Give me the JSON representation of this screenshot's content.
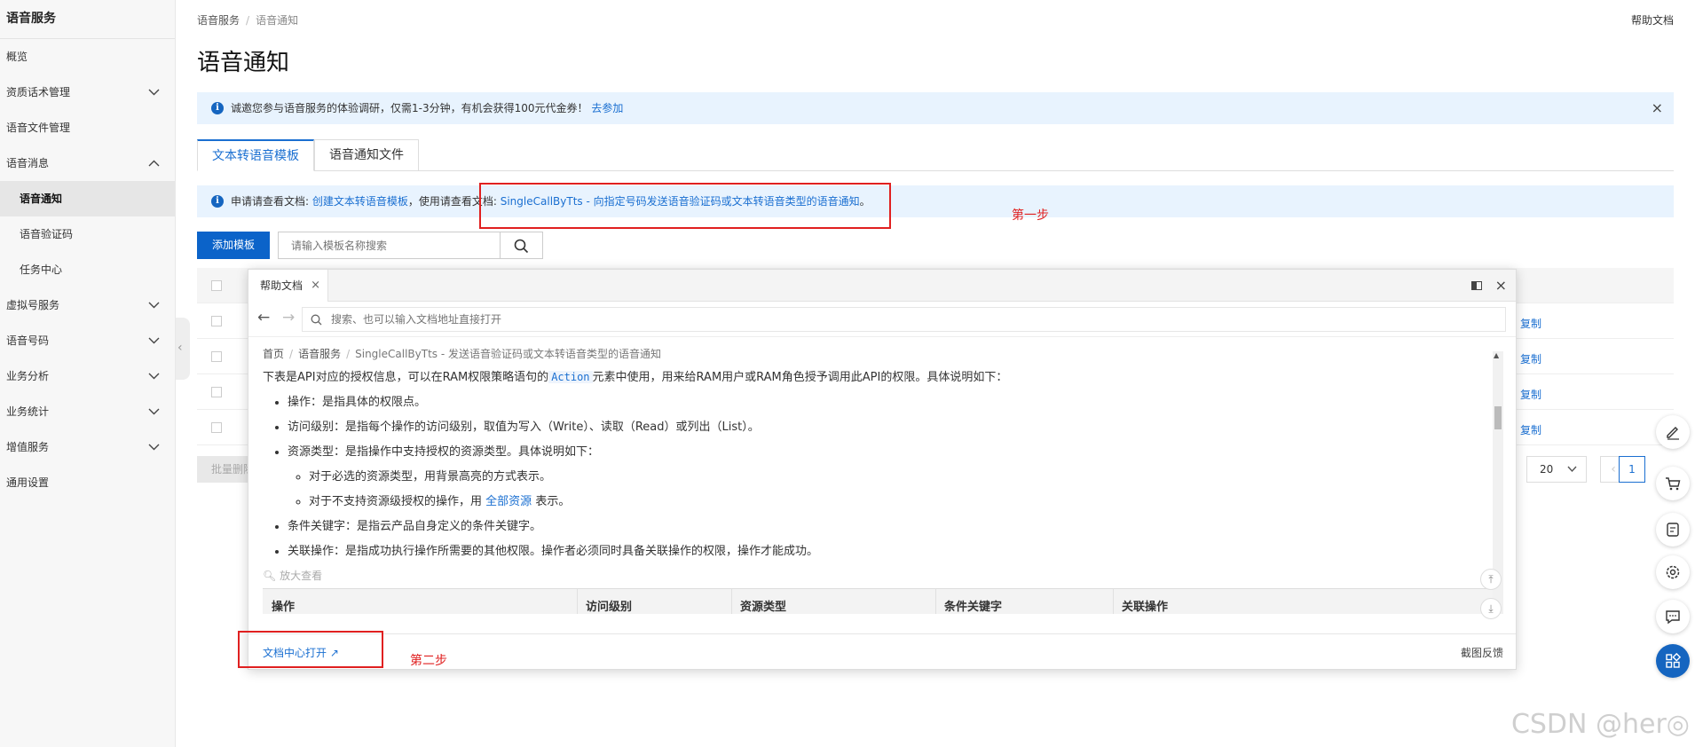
{
  "sidebar": {
    "title": "语音服务",
    "items": [
      {
        "label": "概览",
        "chevron": ""
      },
      {
        "label": "资质话术管理",
        "chevron": "down"
      },
      {
        "label": "语音文件管理",
        "chevron": ""
      },
      {
        "label": "语音消息",
        "chevron": "up"
      },
      {
        "label": "语音通知",
        "chevron": "",
        "sub": true,
        "active": true
      },
      {
        "label": "语音验证码",
        "chevron": "",
        "sub": true
      },
      {
        "label": "任务中心",
        "chevron": "",
        "sub": true
      },
      {
        "label": "虚拟号服务",
        "chevron": "down"
      },
      {
        "label": "语音号码",
        "chevron": "down"
      },
      {
        "label": "业务分析",
        "chevron": "down"
      },
      {
        "label": "业务统计",
        "chevron": "down"
      },
      {
        "label": "增值服务",
        "chevron": "down"
      },
      {
        "label": "通用设置",
        "chevron": ""
      }
    ]
  },
  "breadcrumb": {
    "root": "语音服务",
    "sep": "/",
    "current": "语音通知"
  },
  "header": {
    "help": "帮助文档",
    "title": "语音通知"
  },
  "notice": {
    "text": "诚邀您参与语音服务的体验调研，仅需1-3分钟，有机会获得100元代金券！",
    "link": "去参加",
    "close": "×"
  },
  "tabs": [
    {
      "label": "文本转语音模板"
    },
    {
      "label": "语音通知文件"
    }
  ],
  "tip": {
    "prefix": "申请请查看文档: ",
    "link1": "创建文本转语音模板",
    "middle": "，使用请查看文档: ",
    "link2": "SingleCallByTts - 向指定号码发送语音验证码或文本转语音类型的语音通知",
    "suffix": "。"
  },
  "annotations": {
    "step1": "第一步",
    "step2": "第二步"
  },
  "toolbar": {
    "add_label": "添加模板",
    "search_placeholder": "请输入模板名称搜索"
  },
  "table": {
    "copy_label": "复制",
    "batch_delete": "批量删除"
  },
  "pager": {
    "page_size": "20",
    "current_page": "1",
    "prev": "‹"
  },
  "help_panel": {
    "tab_label": "帮助文档",
    "tab_close": "×",
    "close": "×",
    "search_placeholder": "搜索、也可以输入文档地址直接打开",
    "doc_breadcrumb": [
      "首页",
      "语音服务",
      "SingleCallByTts - 发送语音验证码或文本转语音类型的语音通知"
    ],
    "intro_before": "下表是API对应的授权信息，可以在RAM权限策略语句的",
    "intro_code": "Action",
    "intro_after": "元素中使用，用来给RAM用户或RAM角色授予调用此API的权限。具体说明如下：",
    "bullets": {
      "op": "操作：是指具体的权限点。",
      "access": "访问级别：是指每个操作的访问级别，取值为写入（Write）、读取（Read）或列出（List）。",
      "resource": "资源类型：是指操作中支持授权的资源类型。具体说明如下：",
      "sub1": "对于必选的资源类型，用背景高亮的方式表示。",
      "sub2_before": "对于不支持资源级授权的操作，用",
      "sub2_link": "全部资源",
      "sub2_after": "表示。",
      "condition": "条件关键字：是指云产品自身定义的条件关键字。",
      "related": "关联操作：是指成功执行操作所需要的其他权限。操作者必须同时具备关联操作的权限，操作才能成功。"
    },
    "zoom": "放大查看",
    "table_headers": [
      "操作",
      "访问级别",
      "资源类型",
      "条件关键字",
      "关联操作"
    ],
    "open_center": "文档中心打开",
    "feedback": "截图反馈"
  },
  "watermark": "CSDN @her◎",
  "colors": {
    "brand": "#0b63c9",
    "link": "#1a6fd1",
    "annotation": "#e02020",
    "notice_bg": "#e8f3fe"
  }
}
